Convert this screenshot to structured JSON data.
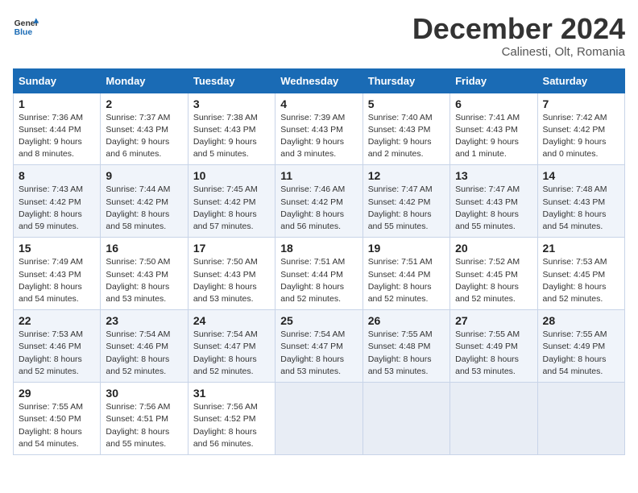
{
  "header": {
    "logo_line1": "General",
    "logo_line2": "Blue",
    "month": "December 2024",
    "location": "Calinesti, Olt, Romania"
  },
  "weekdays": [
    "Sunday",
    "Monday",
    "Tuesday",
    "Wednesday",
    "Thursday",
    "Friday",
    "Saturday"
  ],
  "weeks": [
    [
      {
        "day": "1",
        "info": "Sunrise: 7:36 AM\nSunset: 4:44 PM\nDaylight: 9 hours\nand 8 minutes."
      },
      {
        "day": "2",
        "info": "Sunrise: 7:37 AM\nSunset: 4:43 PM\nDaylight: 9 hours\nand 6 minutes."
      },
      {
        "day": "3",
        "info": "Sunrise: 7:38 AM\nSunset: 4:43 PM\nDaylight: 9 hours\nand 5 minutes."
      },
      {
        "day": "4",
        "info": "Sunrise: 7:39 AM\nSunset: 4:43 PM\nDaylight: 9 hours\nand 3 minutes."
      },
      {
        "day": "5",
        "info": "Sunrise: 7:40 AM\nSunset: 4:43 PM\nDaylight: 9 hours\nand 2 minutes."
      },
      {
        "day": "6",
        "info": "Sunrise: 7:41 AM\nSunset: 4:43 PM\nDaylight: 9 hours\nand 1 minute."
      },
      {
        "day": "7",
        "info": "Sunrise: 7:42 AM\nSunset: 4:42 PM\nDaylight: 9 hours\nand 0 minutes."
      }
    ],
    [
      {
        "day": "8",
        "info": "Sunrise: 7:43 AM\nSunset: 4:42 PM\nDaylight: 8 hours\nand 59 minutes."
      },
      {
        "day": "9",
        "info": "Sunrise: 7:44 AM\nSunset: 4:42 PM\nDaylight: 8 hours\nand 58 minutes."
      },
      {
        "day": "10",
        "info": "Sunrise: 7:45 AM\nSunset: 4:42 PM\nDaylight: 8 hours\nand 57 minutes."
      },
      {
        "day": "11",
        "info": "Sunrise: 7:46 AM\nSunset: 4:42 PM\nDaylight: 8 hours\nand 56 minutes."
      },
      {
        "day": "12",
        "info": "Sunrise: 7:47 AM\nSunset: 4:42 PM\nDaylight: 8 hours\nand 55 minutes."
      },
      {
        "day": "13",
        "info": "Sunrise: 7:47 AM\nSunset: 4:43 PM\nDaylight: 8 hours\nand 55 minutes."
      },
      {
        "day": "14",
        "info": "Sunrise: 7:48 AM\nSunset: 4:43 PM\nDaylight: 8 hours\nand 54 minutes."
      }
    ],
    [
      {
        "day": "15",
        "info": "Sunrise: 7:49 AM\nSunset: 4:43 PM\nDaylight: 8 hours\nand 54 minutes."
      },
      {
        "day": "16",
        "info": "Sunrise: 7:50 AM\nSunset: 4:43 PM\nDaylight: 8 hours\nand 53 minutes."
      },
      {
        "day": "17",
        "info": "Sunrise: 7:50 AM\nSunset: 4:43 PM\nDaylight: 8 hours\nand 53 minutes."
      },
      {
        "day": "18",
        "info": "Sunrise: 7:51 AM\nSunset: 4:44 PM\nDaylight: 8 hours\nand 52 minutes."
      },
      {
        "day": "19",
        "info": "Sunrise: 7:51 AM\nSunset: 4:44 PM\nDaylight: 8 hours\nand 52 minutes."
      },
      {
        "day": "20",
        "info": "Sunrise: 7:52 AM\nSunset: 4:45 PM\nDaylight: 8 hours\nand 52 minutes."
      },
      {
        "day": "21",
        "info": "Sunrise: 7:53 AM\nSunset: 4:45 PM\nDaylight: 8 hours\nand 52 minutes."
      }
    ],
    [
      {
        "day": "22",
        "info": "Sunrise: 7:53 AM\nSunset: 4:46 PM\nDaylight: 8 hours\nand 52 minutes."
      },
      {
        "day": "23",
        "info": "Sunrise: 7:54 AM\nSunset: 4:46 PM\nDaylight: 8 hours\nand 52 minutes."
      },
      {
        "day": "24",
        "info": "Sunrise: 7:54 AM\nSunset: 4:47 PM\nDaylight: 8 hours\nand 52 minutes."
      },
      {
        "day": "25",
        "info": "Sunrise: 7:54 AM\nSunset: 4:47 PM\nDaylight: 8 hours\nand 53 minutes."
      },
      {
        "day": "26",
        "info": "Sunrise: 7:55 AM\nSunset: 4:48 PM\nDaylight: 8 hours\nand 53 minutes."
      },
      {
        "day": "27",
        "info": "Sunrise: 7:55 AM\nSunset: 4:49 PM\nDaylight: 8 hours\nand 53 minutes."
      },
      {
        "day": "28",
        "info": "Sunrise: 7:55 AM\nSunset: 4:49 PM\nDaylight: 8 hours\nand 54 minutes."
      }
    ],
    [
      {
        "day": "29",
        "info": "Sunrise: 7:55 AM\nSunset: 4:50 PM\nDaylight: 8 hours\nand 54 minutes."
      },
      {
        "day": "30",
        "info": "Sunrise: 7:56 AM\nSunset: 4:51 PM\nDaylight: 8 hours\nand 55 minutes."
      },
      {
        "day": "31",
        "info": "Sunrise: 7:56 AM\nSunset: 4:52 PM\nDaylight: 8 hours\nand 56 minutes."
      },
      null,
      null,
      null,
      null
    ]
  ]
}
